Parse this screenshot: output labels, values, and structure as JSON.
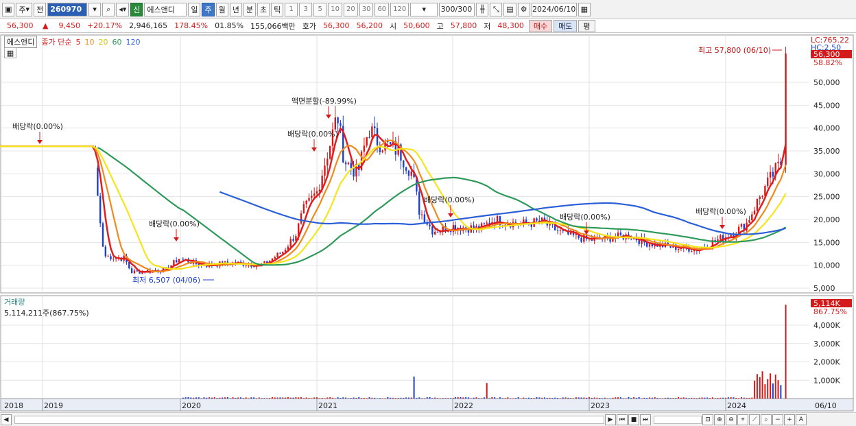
{
  "toolbar": {
    "market_type": "주",
    "prev_label": "전",
    "stock_code": "260970",
    "market_badge": "신",
    "stock_name": "에스앤디",
    "periods": [
      "일",
      "주",
      "월",
      "년",
      "분",
      "초",
      "틱"
    ],
    "active_period": "주",
    "intervals": [
      "1",
      "3",
      "5",
      "10",
      "20",
      "30",
      "60",
      "120"
    ],
    "count": "300/300",
    "date": "2024/06/10"
  },
  "quote": {
    "price": "56,300",
    "arrow": "▲",
    "change": "9,450",
    "change_pct": "+20.17%",
    "volume": "2,946,165",
    "vol_ratio": "178.45%",
    "turnover": "01.85%",
    "amount": "155,066백만",
    "bid_label": "호가",
    "ask": "56,300",
    "bid": "56,200",
    "open_label": "시",
    "open": "50,600",
    "high_label": "고",
    "high": "57,800",
    "low_label": "저",
    "low": "48,300",
    "buy_label": "매수",
    "sell_label": "매도",
    "pyeong_label": "평"
  },
  "legend": {
    "stock": "에스앤디",
    "ma_label": "종가 단순",
    "ma_periods": [
      "5",
      "10",
      "20",
      "60",
      "120"
    ]
  },
  "colors": {
    "up": "#d21a1a",
    "down": "#1a3fd2",
    "ma5": "#e01e1e",
    "ma10": "#f08a1c",
    "ma20": "#f5e51a",
    "ma60": "#2e9a5a",
    "ma120": "#2a5fd8"
  },
  "price_chart": {
    "y_ticks": [
      "50,000",
      "45,000",
      "40,000",
      "35,000",
      "30,000",
      "25,000",
      "20,000",
      "15,000",
      "10,000",
      "5,000"
    ],
    "lc_label": "LC:765.22",
    "hc_label": "HC:2.50",
    "current_price": "56,300",
    "current_pct": "58.82%",
    "high_label": "최고 57,800 (06/10)",
    "low_label": "최저 6,507 (04/06)",
    "annotations": [
      "배당락(0.00%)",
      "배당락(0.00%)",
      "배당락(0.00%)",
      "액면분할(-89.99%)",
      "배당락(0.00%)",
      "배당락(0.00%)",
      "배당락(0.00%)"
    ]
  },
  "volume_chart": {
    "title": "거래량",
    "value": "5,114,211주(867.75%)",
    "y_ticks": [
      "4,000K",
      "3,000K",
      "2,000K",
      "1,000K"
    ],
    "current": "5,114K",
    "current_pct": "867.75%"
  },
  "x_axis": {
    "labels": [
      "2018",
      "2019",
      "2020",
      "2021",
      "2022",
      "2023",
      "2024",
      "06/10"
    ]
  }
}
